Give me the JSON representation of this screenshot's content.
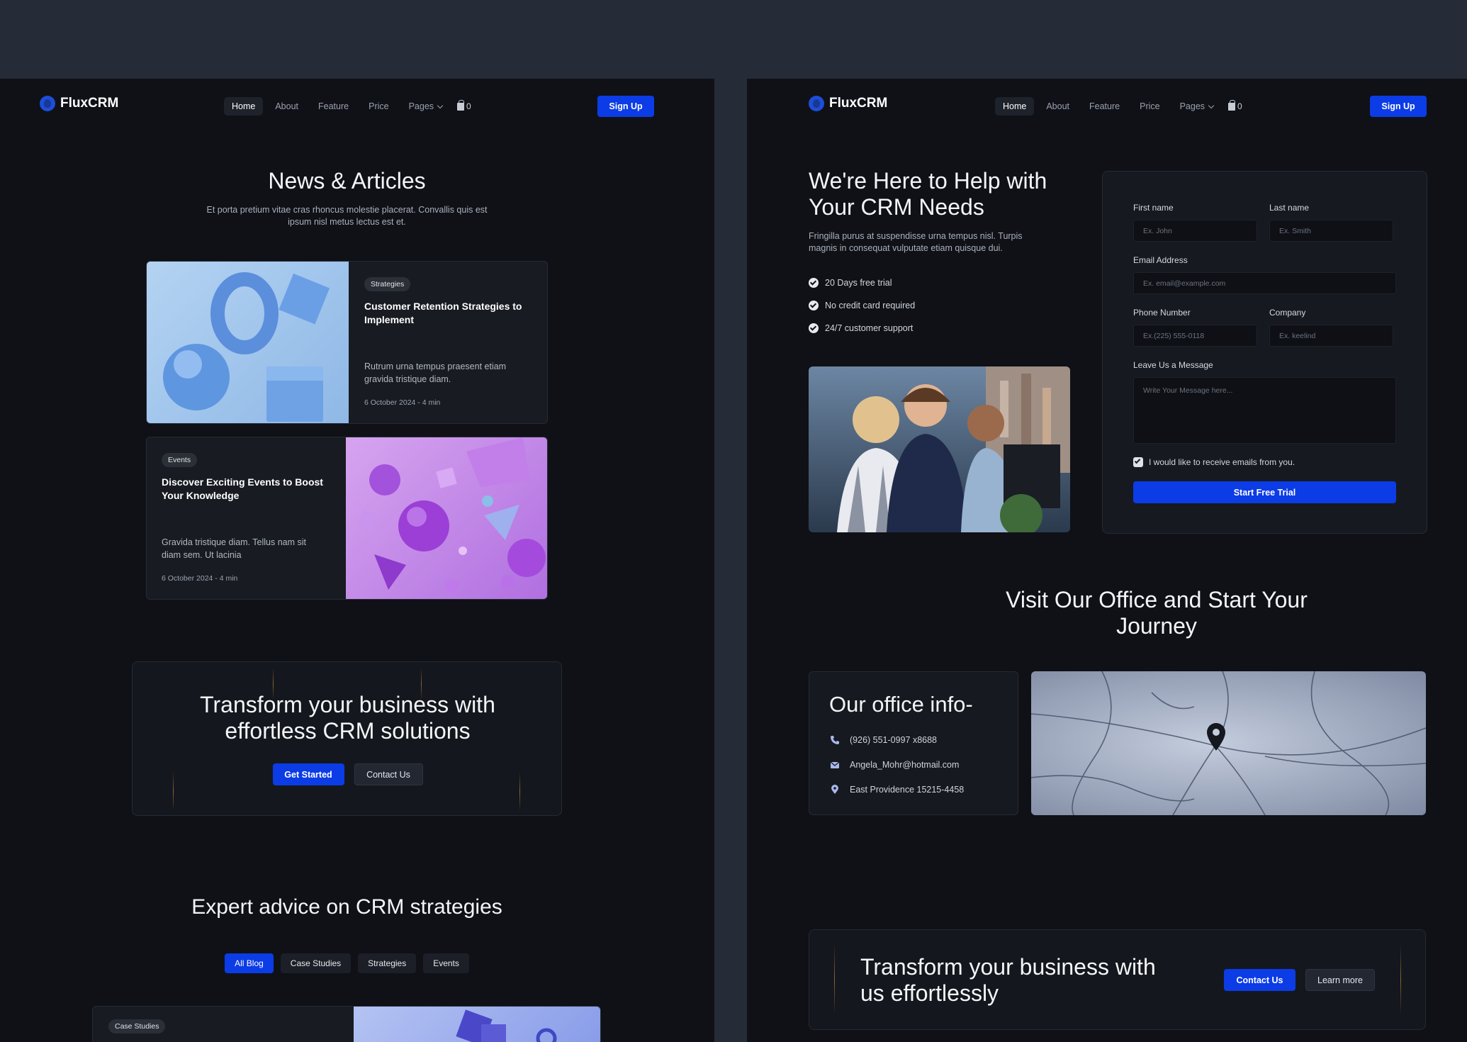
{
  "nav": {
    "logo": "FluxCRM",
    "links": [
      "Home",
      "About",
      "Feature",
      "Price",
      "Pages"
    ],
    "cart_count": "0",
    "signup": "Sign Up"
  },
  "news": {
    "title": "News & Articles",
    "subtitle": "Et porta pretium vitae cras rhoncus molestie placerat. Convallis quis est ipsum nisl metus lectus est et.",
    "articles": [
      {
        "tag": "Strategies",
        "title": "Customer Retention Strategies to Implement",
        "desc": " Rutrum urna tempus praesent etiam gravida tristique diam.",
        "date": "6 October 2024 - 4 min"
      },
      {
        "tag": "Events",
        "title": "Discover Exciting Events to Boost Your Knowledge",
        "desc": "Gravida tristique diam. Tellus nam sit diam sem. Ut lacinia",
        "date": "6 October 2024 - 4 min"
      }
    ]
  },
  "cta_left": {
    "title": "Transform your business with effortless CRM solutions",
    "primary": "Get Started",
    "secondary": "Contact Us"
  },
  "expert": {
    "title": "Expert advice on CRM strategies",
    "tabs": [
      "All Blog",
      "Case Studies",
      "Strategies",
      "Events"
    ],
    "peek_tag": "Case Studies"
  },
  "help": {
    "title": "We're Here to Help with Your CRM Needs",
    "subtitle": "Fringilla purus at suspendisse urna tempus nisl. Turpis magnis in consequat vulputate etiam quisque dui.",
    "checks": [
      "20 Days free trial",
      "No credit card required",
      "24/7 customer support"
    ]
  },
  "form": {
    "first_label": "First name",
    "first_ph": "Ex. John",
    "last_label": "Last name",
    "last_ph": "Ex. Smith",
    "email_label": "Email Address",
    "email_ph": "Ex. email@example.com",
    "phone_label": "Phone Number",
    "phone_ph": "Ex.(225) 555-0118",
    "company_label": "Company",
    "company_ph": "Ex. keelind",
    "message_label": "Leave Us a Message",
    "message_ph": "Write Your Message here...",
    "consent": "I would like to receive emails from you.",
    "submit": "Start Free Trial"
  },
  "office": {
    "title": "Visit Our Office and Start Your Journey",
    "info_title": "Our office info-",
    "phone": "(926) 551-0997 x8688",
    "email": "Angela_Mohr@hotmail.com",
    "address": "East Providence 15215-4458"
  },
  "cta_right": {
    "title": "Transform your business with us effortlessly",
    "primary": "Contact Us",
    "secondary": "Learn more"
  },
  "colors": {
    "accent": "#0b3ce6",
    "background": "#0f1117",
    "outer": "#252b37"
  }
}
